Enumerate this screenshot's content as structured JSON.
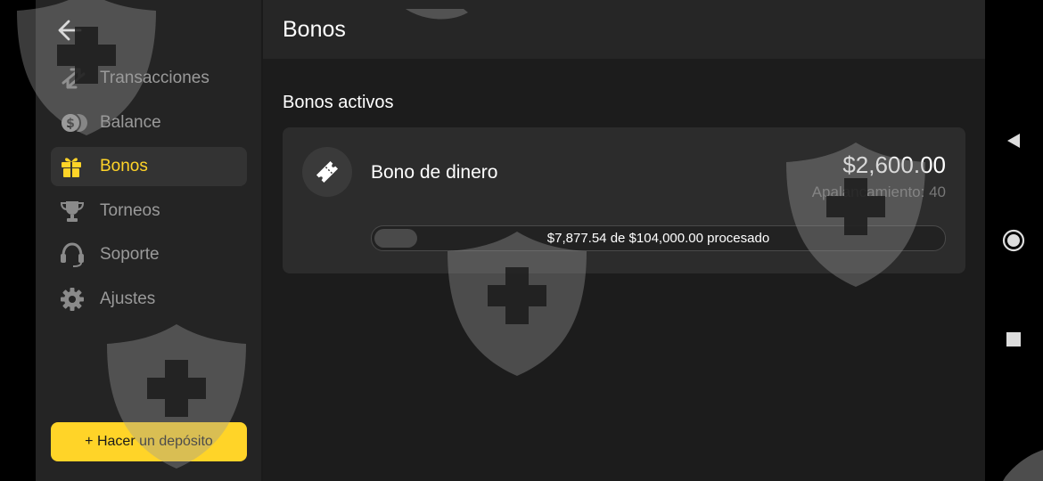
{
  "header": {
    "title": "Bonos"
  },
  "sidebar": {
    "items": [
      {
        "label": "Transacciones",
        "icon": "transfer-arrows-icon"
      },
      {
        "label": "Balance",
        "icon": "coins-icon"
      },
      {
        "label": "Bonos",
        "icon": "gift-icon",
        "active": true
      },
      {
        "label": "Torneos",
        "icon": "trophy-icon"
      },
      {
        "label": "Soporte",
        "icon": "headset-icon"
      },
      {
        "label": "Ajustes",
        "icon": "gear-icon"
      }
    ],
    "deposit_label": "+ Hacer un depósito"
  },
  "main": {
    "section_title": "Bonos activos",
    "bonus": {
      "name": "Bono de dinero",
      "amount": "$2,600.00",
      "leverage": "Apalancamiento: 40",
      "progress_text": "$7,877.54 de $104,000.00 procesado",
      "progress_fraction": 0.0757
    }
  },
  "colors": {
    "accent": "#ffd428",
    "sidebar_bg": "#242424",
    "main_bg": "#1c1c1c",
    "card_bg": "#2c2c2c",
    "muted_text": "#9a9a9a"
  },
  "system_nav": {
    "back_icon": "triangle-back-icon",
    "home_icon": "circle-home-icon",
    "recents_icon": "square-recents-icon"
  }
}
